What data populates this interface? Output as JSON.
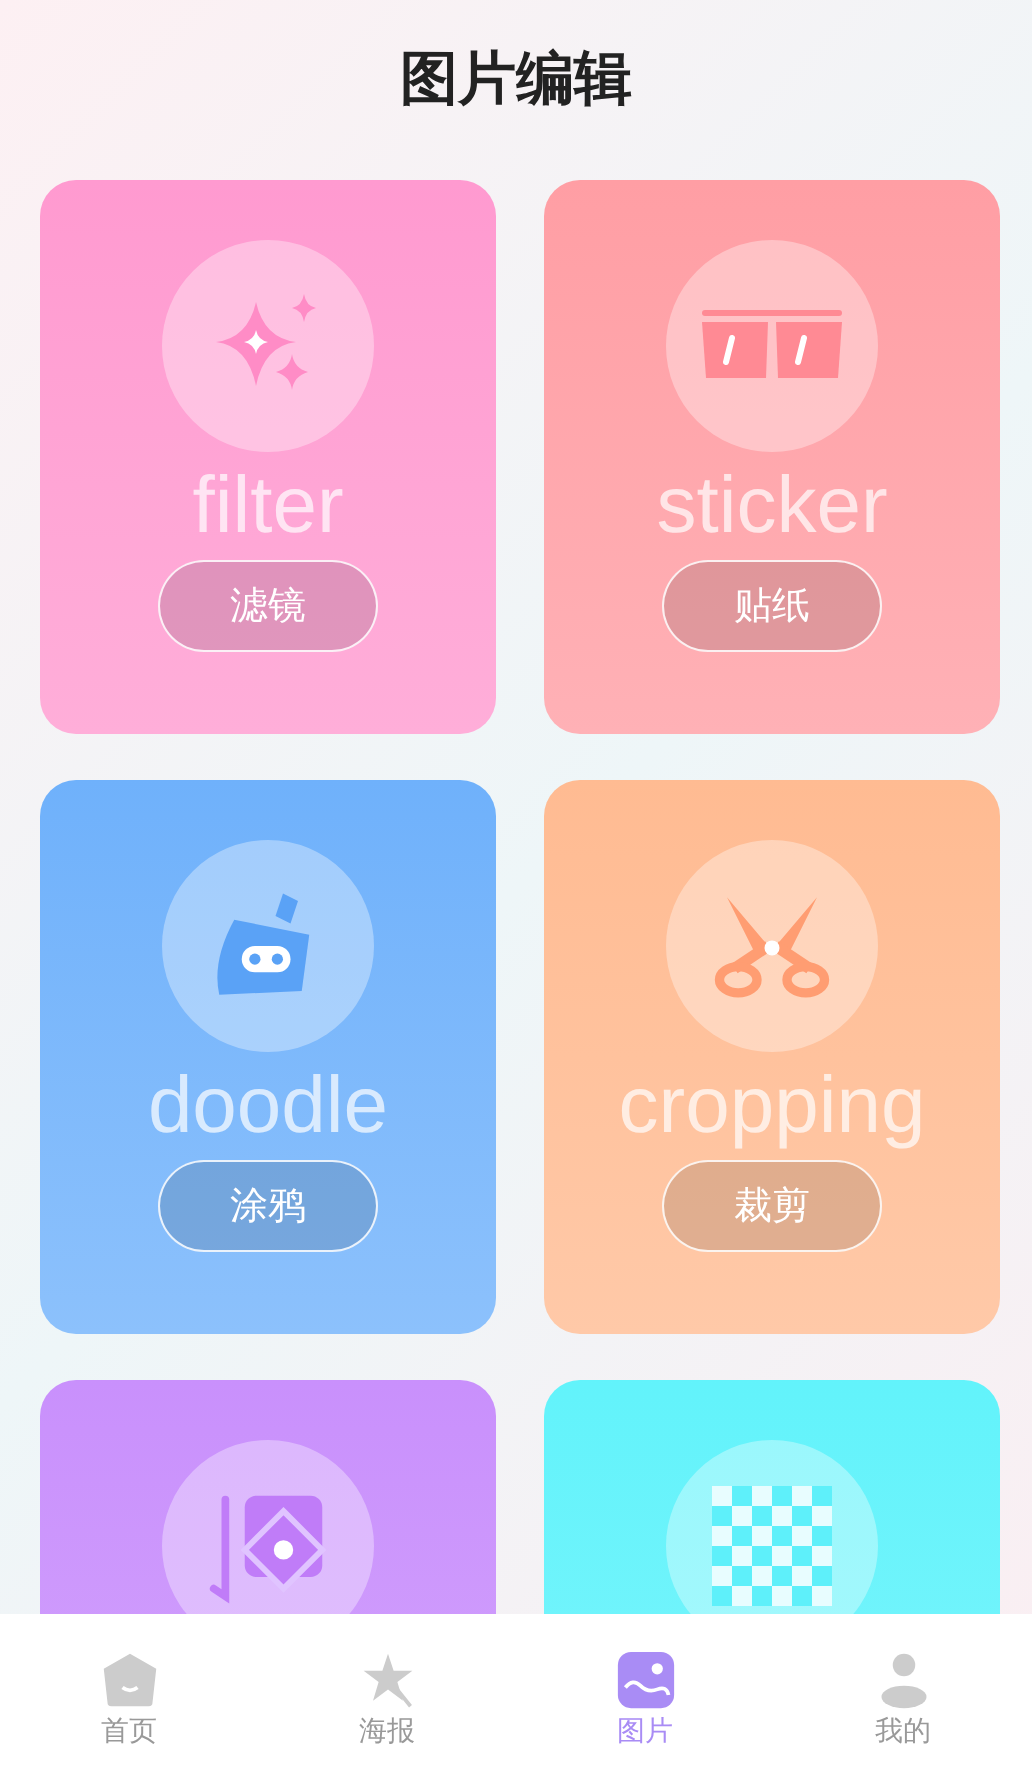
{
  "header": {
    "title": "图片编辑"
  },
  "tools": [
    {
      "kind": "sparkles",
      "color": "#ff9ad0",
      "watermark": "filter",
      "button": "滤镜"
    },
    {
      "kind": "glasses",
      "color": "#ff9ea4",
      "watermark": "sticker",
      "button": "贴纸"
    },
    {
      "kind": "brush",
      "color": "#6fb1fb",
      "watermark": "doodle",
      "button": "涂鸦"
    },
    {
      "kind": "scissors",
      "color": "#ffbb92",
      "watermark": "cropping",
      "button": "裁剪"
    },
    {
      "kind": "frame",
      "color": "#c990fc"
    },
    {
      "kind": "mosaic",
      "color": "#62f3fb"
    }
  ],
  "tabbar": [
    {
      "kind": "home",
      "label": "首页",
      "selected": false
    },
    {
      "kind": "poster",
      "label": "海报",
      "selected": false
    },
    {
      "kind": "picture",
      "label": "图片",
      "selected": true
    },
    {
      "kind": "profile",
      "label": "我的",
      "selected": false
    }
  ]
}
